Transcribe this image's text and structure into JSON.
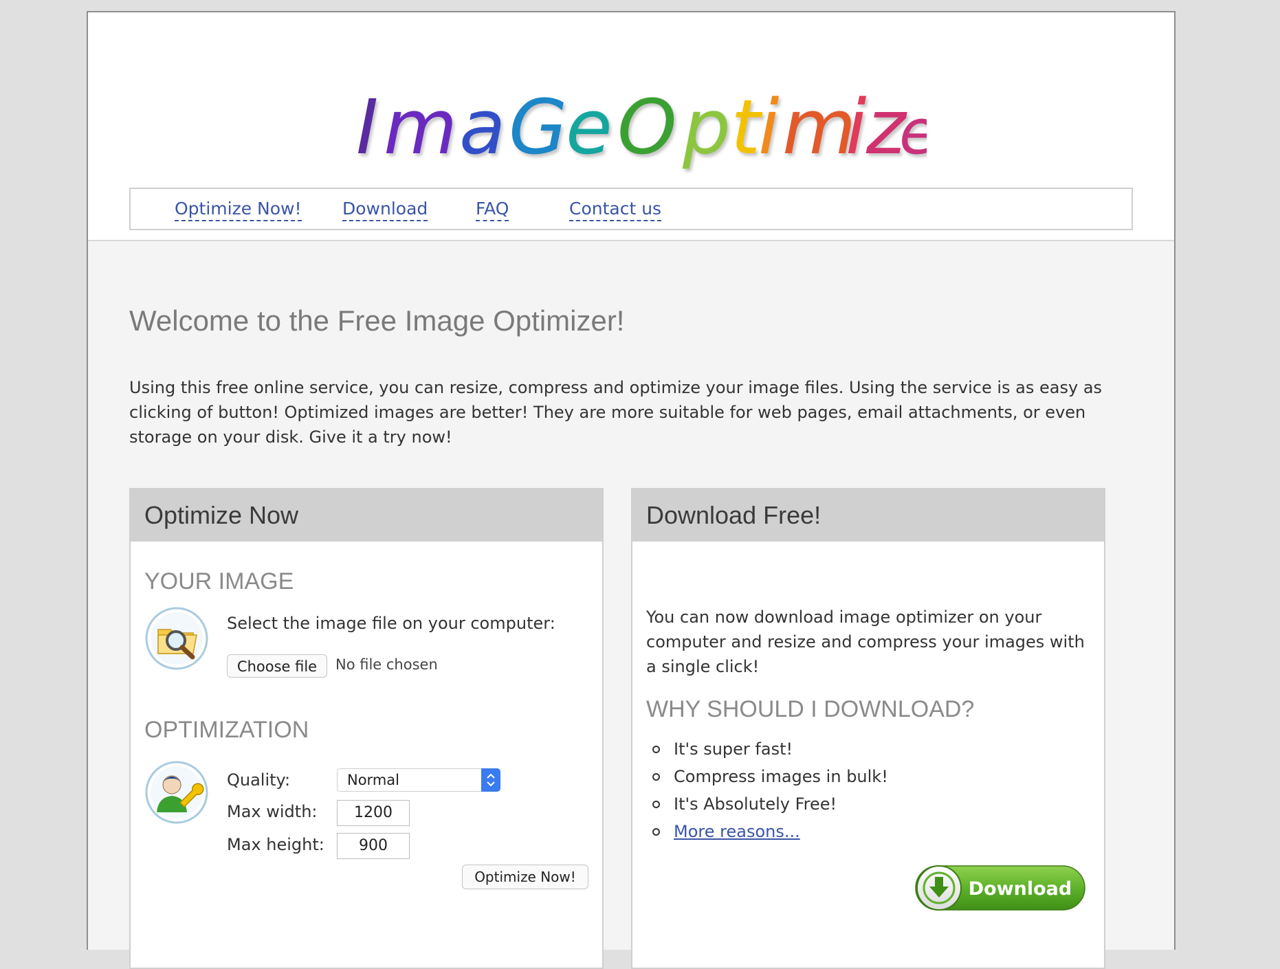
{
  "logo": {
    "text": "Image Optimizer"
  },
  "nav": {
    "items": [
      {
        "label": "Optimize Now!"
      },
      {
        "label": "Download"
      },
      {
        "label": "FAQ"
      },
      {
        "label": "Contact us"
      }
    ]
  },
  "welcome": {
    "title": "Welcome to the Free Image Optimizer!",
    "intro": "Using this free online service, you can resize, compress and optimize your image files. Using the service is as easy as clicking of button! Optimized images are better! They are more suitable for web pages, email attachments, or even storage on your disk. Give it a try now!"
  },
  "optimize_panel": {
    "title": "Optimize Now",
    "your_image": {
      "heading": "YOUR IMAGE",
      "prompt": "Select the image file on your computer:",
      "choose_file_label": "Choose file",
      "file_status": "No file chosen",
      "icon": "folder-search-icon"
    },
    "optimization": {
      "heading": "OPTIMIZATION",
      "icon": "user-wrench-icon",
      "quality_label": "Quality:",
      "quality_value": "Normal",
      "max_width_label": "Max width:",
      "max_width_value": "1200",
      "max_height_label": "Max height:",
      "max_height_value": "900",
      "submit_label": "Optimize Now!"
    }
  },
  "download_panel": {
    "title": "Download Free!",
    "text": "You can now download image optimizer on your computer and resize and compress your images with a single click!",
    "why_heading": "WHY SHOULD I DOWNLOAD?",
    "reasons": [
      {
        "text": "It's super fast!"
      },
      {
        "text": "Compress images in bulk!"
      },
      {
        "text": "It's Absolutely Free!"
      }
    ],
    "more_link": "More reasons...",
    "button_label": "Download",
    "button_icon": "download-arrow-icon"
  },
  "colors": {
    "link": "#3a55a6",
    "panel_header": "#d0d0d0",
    "download_green": "#5fb22a",
    "select_accent": "#3b7bf0"
  }
}
